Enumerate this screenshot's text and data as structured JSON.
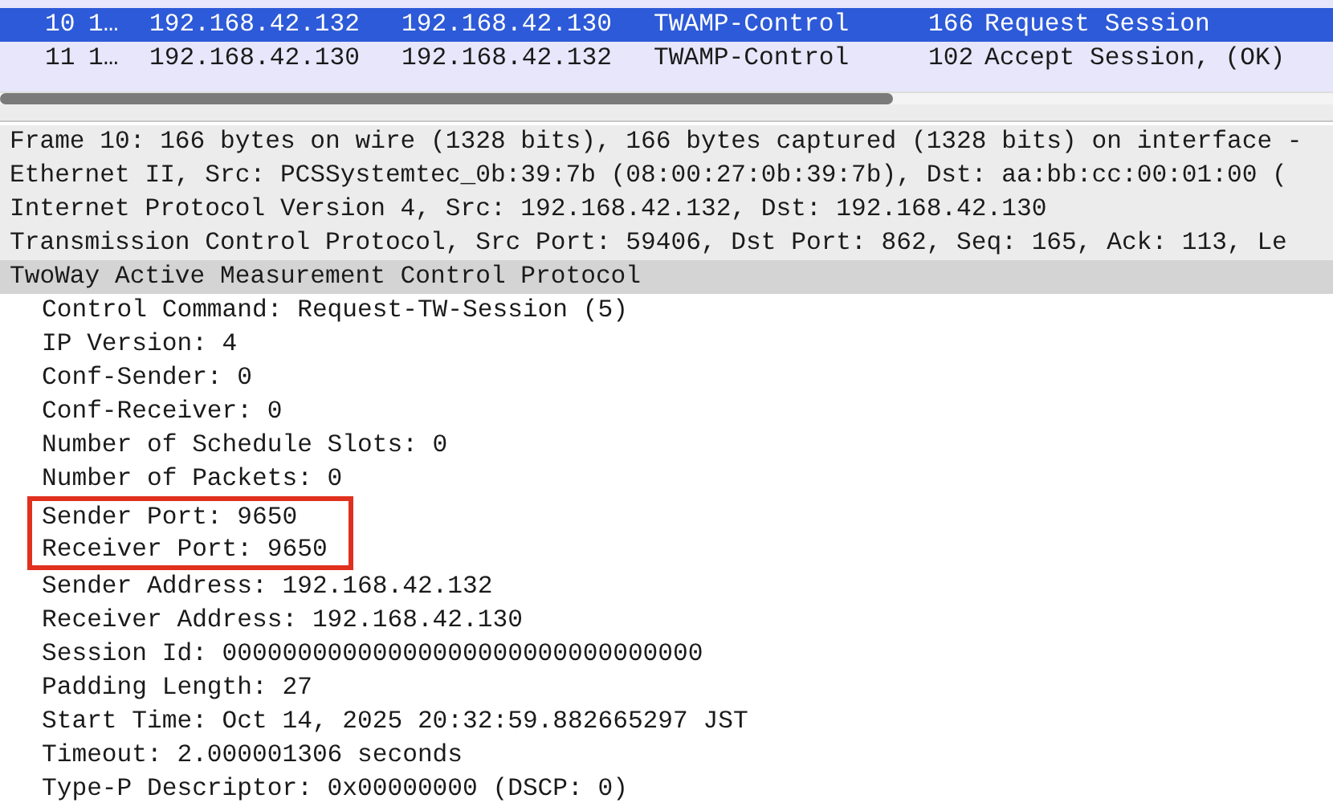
{
  "packet_list": {
    "rows": [
      {
        "no": "10",
        "time": "1…",
        "source": "192.168.42.132",
        "destination": "192.168.42.130",
        "protocol": "TWAMP-Control",
        "length": "166",
        "info": "Request Session",
        "selected": true
      },
      {
        "no": "11",
        "time": "1…",
        "source": "192.168.42.130",
        "destination": "192.168.42.132",
        "protocol": "TWAMP-Control",
        "length": "102",
        "info": "Accept Session, (OK)",
        "selected": false
      }
    ]
  },
  "detail_tree": [
    {
      "text": "Frame 10: 166 bytes on wire (1328 bits), 166 bytes captured (1328 bits) on interface -",
      "selected": false
    },
    {
      "text": "Ethernet II, Src: PCSSystemtec_0b:39:7b (08:00:27:0b:39:7b), Dst: aa:bb:cc:00:01:00 (",
      "selected": false
    },
    {
      "text": "Internet Protocol Version 4, Src: 192.168.42.132, Dst: 192.168.42.130",
      "selected": false
    },
    {
      "text": "Transmission Control Protocol, Src Port: 59406, Dst Port: 862, Seq: 165, Ack: 113, Le",
      "selected": false
    },
    {
      "text": "TwoWay Active Measurement Control Protocol",
      "selected": true,
      "children": [
        {
          "text": "Control Command: Request-TW-Session (5)",
          "boxed": false
        },
        {
          "text": "IP Version: 4",
          "boxed": false
        },
        {
          "text": "Conf-Sender: 0",
          "boxed": false
        },
        {
          "text": "Conf-Receiver: 0",
          "boxed": false
        },
        {
          "text": "Number of Schedule Slots: 0",
          "boxed": false
        },
        {
          "text": "Number of Packets: 0",
          "boxed": false
        },
        {
          "text": "Sender Port: 9650",
          "boxed": true
        },
        {
          "text": "Receiver Port: 9650",
          "boxed": true
        },
        {
          "text": "Sender Address: 192.168.42.132",
          "boxed": false
        },
        {
          "text": "Receiver Address: 192.168.42.130",
          "boxed": false
        },
        {
          "text": "Session Id: 00000000000000000000000000000000",
          "boxed": false
        },
        {
          "text": "Padding Length: 27",
          "boxed": false
        },
        {
          "text": "Start Time: Oct 14, 2025 20:32:59.882665297 JST",
          "boxed": false
        },
        {
          "text": "Timeout: 2.000001306 seconds",
          "boxed": false
        },
        {
          "text": "Type-P Descriptor: 0x00000000 (DSCP: 0)",
          "boxed": false
        }
      ]
    }
  ]
}
